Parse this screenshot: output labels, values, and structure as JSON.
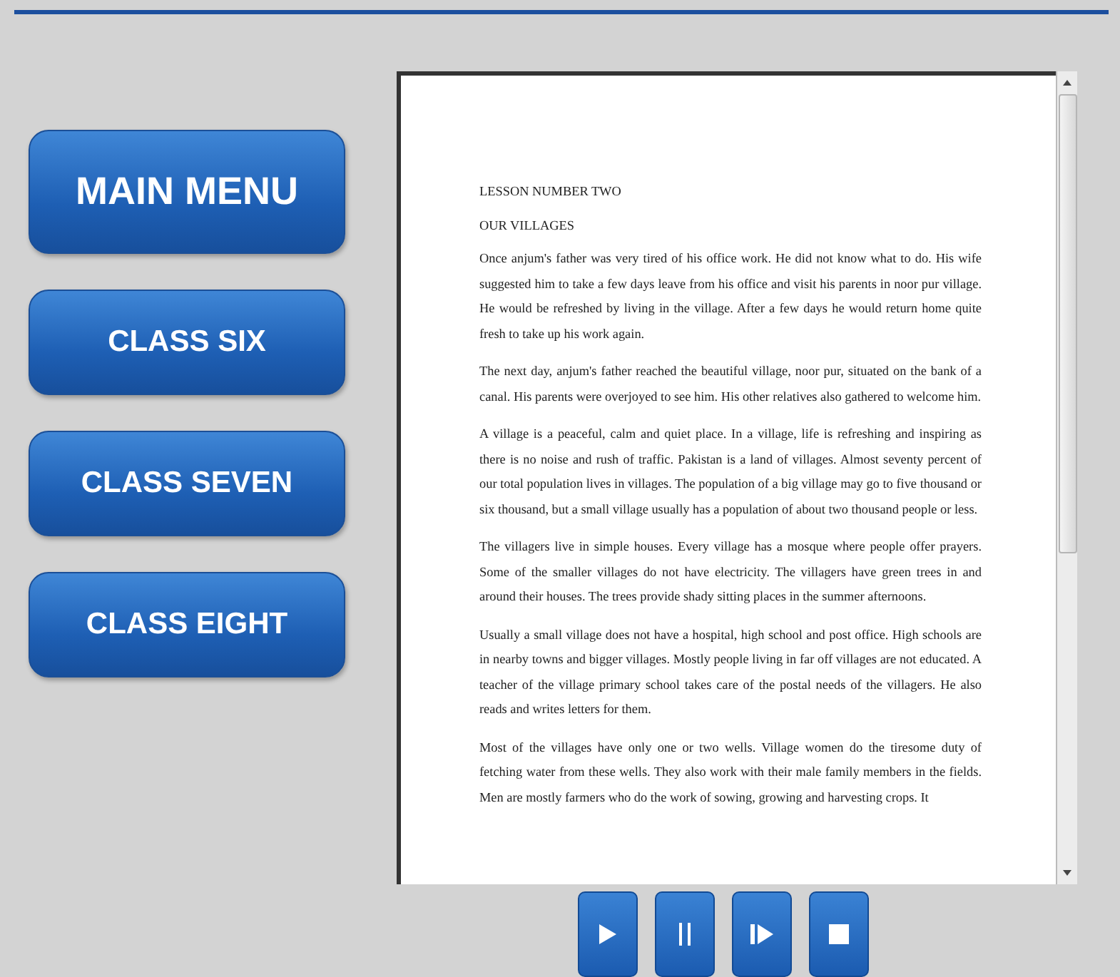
{
  "menu": [
    {
      "label": "MAIN MENU",
      "kind": "large"
    },
    {
      "label": "CLASS SIX",
      "kind": "normal"
    },
    {
      "label": "CLASS SEVEN",
      "kind": "normal"
    },
    {
      "label": "CLASS EIGHT",
      "kind": "normal"
    }
  ],
  "document": {
    "heading": "LESSON NUMBER TWO",
    "title": "OUR VILLAGES",
    "paragraphs": [
      "Once anjum's father was very tired of his office work. He did not know what to do. His wife suggested him to take a few days leave from his office and visit his parents in noor pur village. He would be refreshed by living in the village. After a few days he would return home quite fresh to take up his work again.",
      "The next day, anjum's father reached the beautiful village, noor pur, situated on the bank of a canal. His parents were overjoyed to see him. His other relatives also gathered to welcome him.",
      "A village is a peaceful, calm and quiet place. In a village, life is refreshing and inspiring as there is no noise and rush of traffic. Pakistan is a land of villages. Almost seventy percent of our total population lives in villages. The population of a big village may go to five thousand or six thousand, but a small village usually has a population of about two thousand people or less.",
      "The villagers live in simple houses. Every village has a mosque where people offer prayers. Some of the smaller villages do not have electricity. The villagers have green trees in and around their houses. The trees provide shady sitting places in the summer afternoons.",
      "Usually a small village does not have a hospital, high school and post office. High schools are in nearby towns and bigger villages. Mostly people living in far off villages are not educated. A teacher of the village primary school takes care of the postal needs of the villagers. He also reads and writes letters for them.",
      "Most of the villages have only one or two wells. Village women do the tiresome duty of fetching water from these wells. They also work with their male family members in the fields. Men are mostly farmers who do the work of sowing, growing and harvesting crops. It"
    ]
  },
  "controls": [
    {
      "kind": "play"
    },
    {
      "kind": "pause"
    },
    {
      "kind": "step"
    },
    {
      "kind": "stop"
    }
  ]
}
